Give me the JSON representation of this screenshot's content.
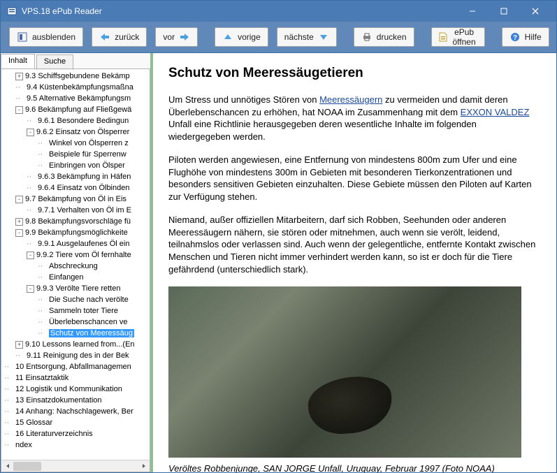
{
  "window": {
    "title": "VPS.18 ePub Reader"
  },
  "toolbar": {
    "ausblenden": "ausblenden",
    "zurueck": "zurück",
    "vor": "vor",
    "vorige": "vorige",
    "naechste": "nächste",
    "drucken": "drucken",
    "epub_oeffnen": "ePub öffnen",
    "hilfe": "Hilfe"
  },
  "tabs": {
    "inhalt": "Inhalt",
    "suche": "Suche"
  },
  "tree": [
    {
      "indent": 0,
      "toggle": "+",
      "label": "9.3 Schiffsgebundene Bekämp"
    },
    {
      "indent": 0,
      "toggle": "",
      "label": "9.4 Küstenbekämpfungsmaßna"
    },
    {
      "indent": 0,
      "toggle": "",
      "label": "9.5 Alternative Bekämpfungsm"
    },
    {
      "indent": 0,
      "toggle": "-",
      "label": "9.6 Bekämpfung auf Fließgewä"
    },
    {
      "indent": 1,
      "toggle": "",
      "label": "9.6.1 Besondere Bedingun"
    },
    {
      "indent": 1,
      "toggle": "-",
      "label": "9.6.2 Einsatz von Ölsperrer"
    },
    {
      "indent": 2,
      "toggle": "",
      "label": "Winkel von Ölsperren z"
    },
    {
      "indent": 2,
      "toggle": "",
      "label": "Beispiele für Sperrenw"
    },
    {
      "indent": 2,
      "toggle": "",
      "label": "Einbringen von Ölsper"
    },
    {
      "indent": 1,
      "toggle": "",
      "label": "9.6.3 Bekämpfung in Häfen"
    },
    {
      "indent": 1,
      "toggle": "",
      "label": "9.6.4 Einsatz von Ölbinden"
    },
    {
      "indent": 0,
      "toggle": "-",
      "label": "9.7 Bekämpfung von Öl in Eis"
    },
    {
      "indent": 1,
      "toggle": "",
      "label": "9.7.1 Verhalten von Öl im E"
    },
    {
      "indent": 0,
      "toggle": "+",
      "label": "9.8 Bekämpfungsvorschläge fü"
    },
    {
      "indent": 0,
      "toggle": "-",
      "label": "9.9 Bekämpfungsmöglichkeite"
    },
    {
      "indent": 1,
      "toggle": "",
      "label": "9.9.1 Ausgelaufenes Öl ein"
    },
    {
      "indent": 1,
      "toggle": "-",
      "label": "9.9.2 Tiere vom Öl fernhalte"
    },
    {
      "indent": 2,
      "toggle": "",
      "label": "Abschreckung"
    },
    {
      "indent": 2,
      "toggle": "",
      "label": "Einfangen"
    },
    {
      "indent": 1,
      "toggle": "-",
      "label": "9.9.3 Verölte Tiere retten"
    },
    {
      "indent": 2,
      "toggle": "",
      "label": "Die Suche nach verölte"
    },
    {
      "indent": 2,
      "toggle": "",
      "label": "Sammeln toter Tiere"
    },
    {
      "indent": 2,
      "toggle": "",
      "label": "Überlebenschancen ve"
    },
    {
      "indent": 2,
      "toggle": "",
      "label": "Schutz von Meeressäug",
      "selected": true
    },
    {
      "indent": 0,
      "toggle": "+",
      "label": "9.10 Lessons learned from...(En"
    },
    {
      "indent": 0,
      "toggle": "",
      "label": "9.11 Reinigung des in der Bek"
    },
    {
      "indent": -1,
      "toggle": "",
      "label": "10 Entsorgung, Abfallmanagemen"
    },
    {
      "indent": -1,
      "toggle": "",
      "label": "11 Einsatztaktik"
    },
    {
      "indent": -1,
      "toggle": "",
      "label": "12 Logistik und Kommunikation"
    },
    {
      "indent": -1,
      "toggle": "",
      "label": "13 Einsatzdokumentation"
    },
    {
      "indent": -1,
      "toggle": "",
      "label": "14 Anhang: Nachschlagewerk, Ber"
    },
    {
      "indent": -1,
      "toggle": "",
      "label": "15 Glossar"
    },
    {
      "indent": -1,
      "toggle": "",
      "label": "16 Literaturverzeichnis"
    },
    {
      "indent": -1,
      "toggle": "",
      "label": "ndex"
    }
  ],
  "content": {
    "heading": "Schutz von Meeressäugetieren",
    "p1_a": "Um Stress und unnötiges Stören von ",
    "link1": "Meeressäugern",
    "p1_b": " zu vermeiden und damit deren Überlebenschancen zu erhöhen, hat NOAA im Zusammenhang mit dem ",
    "link2": "EXXON VALDEZ",
    "p1_c": " Unfall eine Richtlinie herausgegeben deren wesentliche Inhalte im folgenden wiedergegeben werden.",
    "p2": "Piloten werden angewiesen, eine Entfernung von mindestens 800m zum Ufer und eine Flughöhe von mindestens 300m in Gebieten mit besonderen Tierkonzentrationen und besonders sensitiven Gebieten einzuhalten. Diese Gebiete müssen den Piloten auf Karten zur Verfügung stehen.",
    "p3": "Niemand, außer offiziellen Mitarbeitern, darf sich Robben, Seehunden oder anderen Meeressäugern nähern, sie stören oder mitnehmen, auch wenn sie verölt, leidend, teilnahmslos oder verlassen sind. Auch wenn der gelegentliche, entfernte Kontakt zwischen Menschen und Tieren nicht immer verhindert werden kann, so ist er doch für die Tiere gefährdend (unterschiedlich stark).",
    "caption": "Veröltes Robbenjunge, SAN JORGE Unfall, Uruguay, Februar 1997 (Foto NOAA)"
  }
}
